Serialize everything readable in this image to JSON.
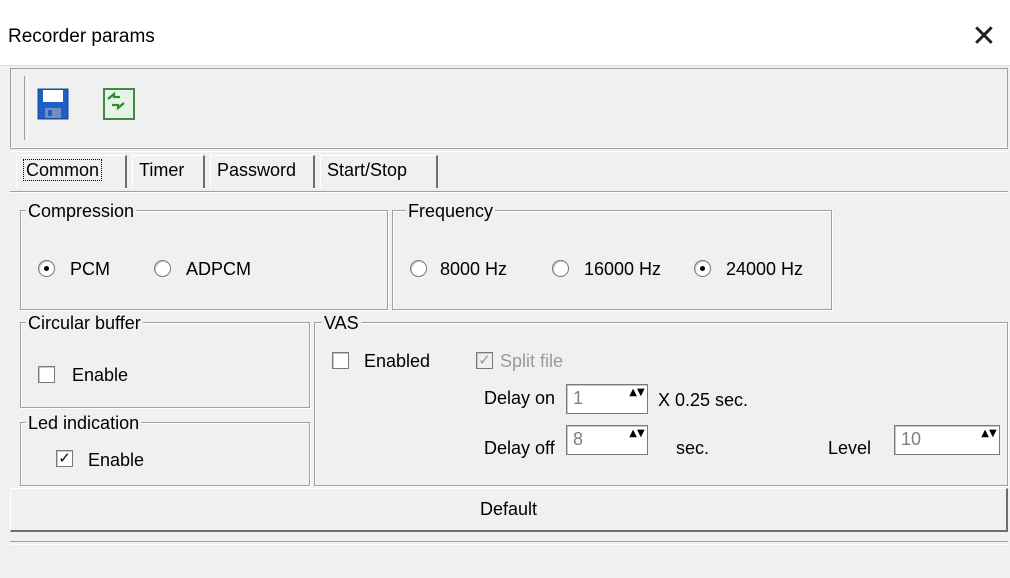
{
  "window": {
    "title": "Recorder params",
    "close_glyph": "✕"
  },
  "toolbar": {
    "buttons": [
      {
        "icon": "floppy-save-icon",
        "tooltip": ""
      },
      {
        "icon": "refresh-arrows-icon",
        "tooltip": ""
      }
    ]
  },
  "tabs": [
    {
      "label": "Common",
      "selected": true
    },
    {
      "label": "Timer",
      "selected": false
    },
    {
      "label": "Password",
      "selected": false
    },
    {
      "label": "Start/Stop",
      "selected": false
    }
  ],
  "compression": {
    "label": "Compression",
    "options": [
      {
        "label": "PCM",
        "checked": true
      },
      {
        "label": "ADPCM",
        "checked": false
      }
    ]
  },
  "frequency": {
    "label": "Frequency",
    "options": [
      {
        "label": "8000 Hz",
        "checked": false
      },
      {
        "label": "16000 Hz",
        "checked": false
      },
      {
        "label": "24000 Hz",
        "checked": true
      }
    ]
  },
  "circular_buffer": {
    "label": "Circular buffer",
    "enable_label": "Enable",
    "enabled": false
  },
  "led_indication": {
    "label": "Led indication",
    "enable_label": "Enable",
    "enabled": true
  },
  "vas": {
    "label": "VAS",
    "enabled_label": "Enabled",
    "enabled": false,
    "split_file_label": "Split file",
    "split_file": true,
    "delay_on_label": "Delay on",
    "delay_on_value": "1",
    "delay_on_unit": "X 0.25 sec.",
    "delay_off_label": "Delay off",
    "delay_off_value": "8",
    "delay_off_unit": "sec.",
    "level_label": "Level",
    "level_value": "10"
  },
  "default_button": {
    "label": "Default"
  },
  "glyphs": {
    "check": "✓",
    "spin": "▲▼"
  }
}
